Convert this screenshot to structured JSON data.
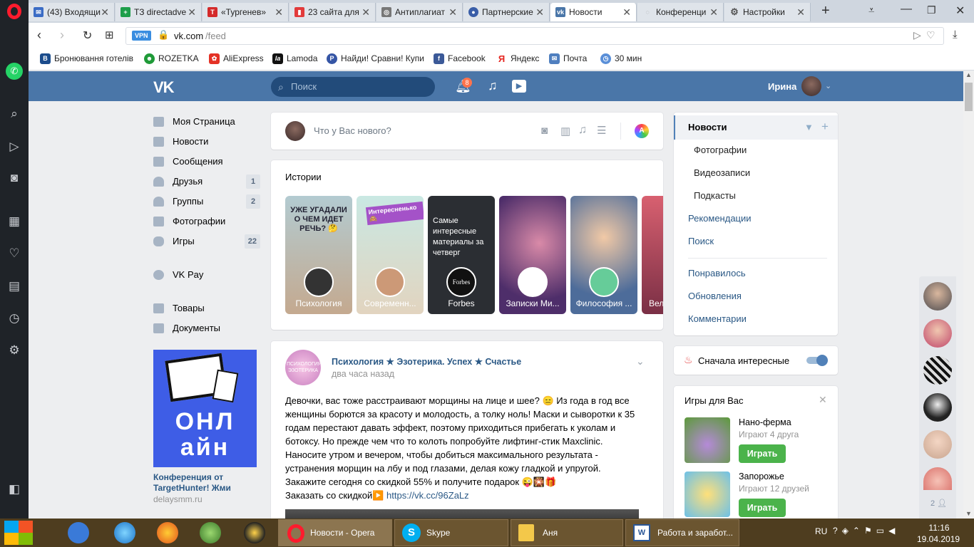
{
  "browser": {
    "tabs": [
      {
        "label": "(43) Входящи",
        "color": "#3b6cc5",
        "glyph": "✉"
      },
      {
        "label": "ТЗ directadve",
        "color": "#1e9e4a",
        "glyph": "+"
      },
      {
        "label": "«Тургенев»",
        "color": "#d42a2a",
        "glyph": "T"
      },
      {
        "label": "23 сайта для",
        "color": "#e23b3b",
        "glyph": "▮"
      },
      {
        "label": "Антиплагиат",
        "color": "#777777",
        "glyph": "◎"
      },
      {
        "label": "Партнерские",
        "color": "#3a5ea8",
        "glyph": "●"
      },
      {
        "label": "Новости",
        "color": "#4a76a8",
        "glyph": "vk"
      },
      {
        "label": "Конференци",
        "color": "#999999",
        "glyph": "◌"
      },
      {
        "label": "Настройки",
        "color": "#666666",
        "glyph": "⚙"
      }
    ],
    "vpn": "VPN",
    "url_host": "vk.com",
    "url_path": "/feed",
    "bookmarks": [
      {
        "label": "Бронювання готелів",
        "color": "#1b4c8c",
        "glyph": "B"
      },
      {
        "label": "ROZETKA",
        "color": "#1f9a38",
        "glyph": "☻"
      },
      {
        "label": "AliExpress",
        "color": "#e43226",
        "glyph": "✿"
      },
      {
        "label": "Lamoda",
        "color": "#111111",
        "glyph": "la"
      },
      {
        "label": "Найди! Сравни! Купи",
        "color": "#3555a5",
        "glyph": "P"
      },
      {
        "label": "Facebook",
        "color": "#3b5998",
        "glyph": "f"
      },
      {
        "label": "Яндекс",
        "color": "#ffffff",
        "glyph": "Я"
      },
      {
        "label": "Почта",
        "color": "#4f7fbf",
        "glyph": "✉"
      },
      {
        "label": "30 мин",
        "color": "#5a8fd8",
        "glyph": "◷"
      }
    ]
  },
  "vk": {
    "search_placeholder": "Поиск",
    "notif_count": "8",
    "user_name": "Ирина",
    "menu": [
      {
        "label": "Моя Страница",
        "count": ""
      },
      {
        "label": "Новости",
        "count": ""
      },
      {
        "label": "Сообщения",
        "count": ""
      },
      {
        "label": "Друзья",
        "count": "1"
      },
      {
        "label": "Группы",
        "count": "2"
      },
      {
        "label": "Фотографии",
        "count": ""
      },
      {
        "label": "Игры",
        "count": "22"
      },
      {
        "label": "VK Pay",
        "count": ""
      },
      {
        "label": "Товары",
        "count": ""
      },
      {
        "label": "Документы",
        "count": ""
      }
    ],
    "ad": {
      "banner_line1": "ОНЛ",
      "banner_line2": "АЙН",
      "title": "Конференция от TargetHunter! Жми",
      "domain": "delaysmm.ru"
    },
    "composer_placeholder": "Что у Вас нового?",
    "stories_title": "Истории",
    "stories": [
      {
        "label": "Психология",
        "text": "УЖЕ УГАДАЛИ О ЧЕМ ИДЕТ РЕЧЬ? 🤔",
        "bg": "#a9c2c9"
      },
      {
        "label": "Современн...",
        "text": "Интересненько🙈",
        "bg": "#d8ece8"
      },
      {
        "label": "Forbes",
        "text": "Самые интересные материалы за четверг",
        "bg": "#2c2f33"
      },
      {
        "label": "Записки Ми...",
        "text": "",
        "bg": "#7a3e7e"
      },
      {
        "label": "Философия ...",
        "text": "",
        "bg": "#3f5b86"
      },
      {
        "label": "Вел",
        "text": "",
        "bg": "#b7455a"
      }
    ],
    "post": {
      "author": "Психология ★ Эзотерика. Успех ★ Счастье",
      "time": "два часа назад",
      "avatar_text": "ПСИХОЛОГИЯ ЭЗОТЕРИКА",
      "lines": [
        "Девочки, вас тоже расстраивают морщины на лице и шее? 😑 Из года в год все",
        "женщины борются за красоту и молодость, а толку ноль! Маски и сыворотки к 35",
        "годам перестают давать эффект, поэтому приходиться прибегать к уколам и",
        "ботоксу. Но прежде чем что то колоть попробуйте лифтинг-стик Maxclinic.",
        "Наносите утром и вечером, чтобы добиться максимального результата -",
        "устранения морщин на лбу и под глазами, делая кожу гладкой и упругой.",
        "Закажите сегодня со скидкой 55% и получите подарок 😜🎇🎁"
      ],
      "order_text": "Заказать со скидкой▶️",
      "link": "https://vk.cc/96ZaLz"
    },
    "right_nav": {
      "active": "Новости",
      "subs": [
        "Фотографии",
        "Видеозаписи",
        "Подкасты"
      ],
      "main": [
        "Рекомендации",
        "Поиск"
      ],
      "extra": [
        "Понравилось",
        "Обновления",
        "Комментарии"
      ]
    },
    "interesting_first": "Сначала интересные",
    "games": {
      "title": "Игры для Вас",
      "items": [
        {
          "name": "Нано-ферма",
          "friends": "Играют 4 друга",
          "play": "Играть"
        },
        {
          "name": "Запорожье",
          "friends": "Играют 12 друзей",
          "play": "Играть"
        }
      ]
    },
    "chats_count": "2"
  },
  "taskbar": {
    "items": [
      {
        "label": "Новости - Opera"
      },
      {
        "label": "Skype"
      },
      {
        "label": "Аня"
      },
      {
        "label": "Работа и заработ..."
      }
    ],
    "lang": "RU",
    "time": "11:16",
    "date": "19.04.2019"
  }
}
